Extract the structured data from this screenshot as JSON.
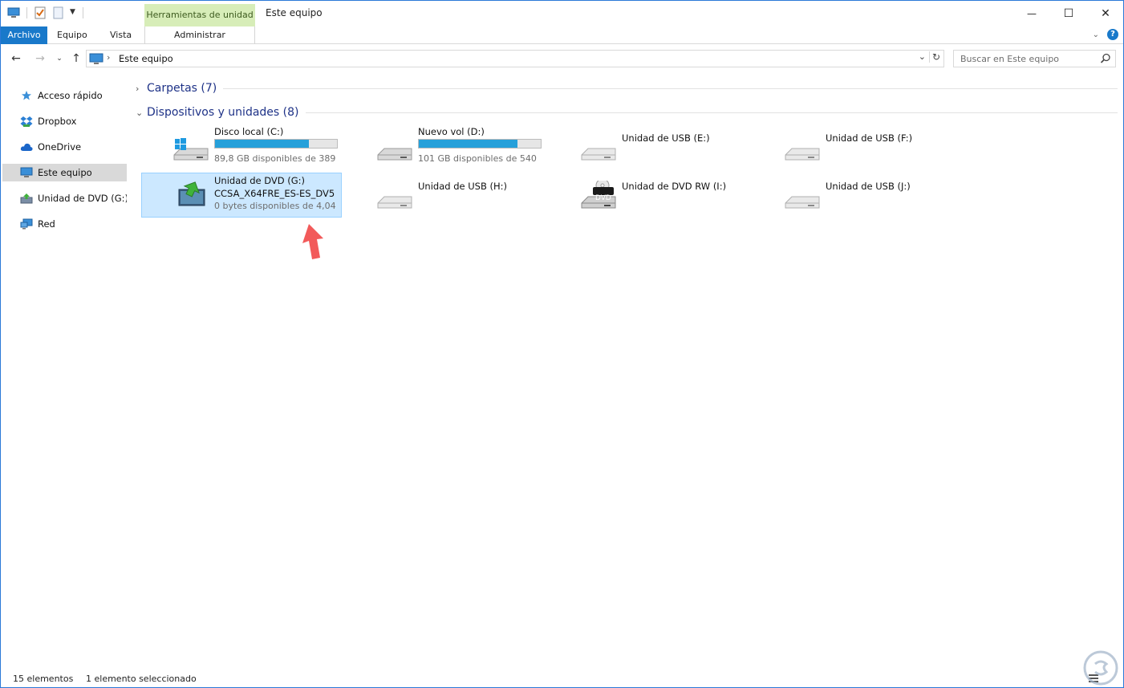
{
  "titlebar": {
    "context_tab": "Herramientas de unidad",
    "title": "Este equipo",
    "minimize": "—",
    "maximize": "☐",
    "close": "✕"
  },
  "ribbon": {
    "tabs": [
      "Archivo",
      "Equipo",
      "Vista"
    ],
    "context_sub": "Administrar"
  },
  "address": {
    "path": "Este equipo",
    "search_placeholder": "Buscar en Este equipo"
  },
  "sidebar": {
    "items": [
      {
        "label": "Acceso rápido",
        "icon": "star-icon"
      },
      {
        "label": "Dropbox",
        "icon": "dropbox-icon"
      },
      {
        "label": "OneDrive",
        "icon": "cloud-icon"
      },
      {
        "label": "Este equipo",
        "icon": "computer-icon",
        "selected": true
      },
      {
        "label": "Unidad de DVD (G:) C",
        "icon": "dvd-drive-icon"
      },
      {
        "label": "Red",
        "icon": "network-icon"
      }
    ]
  },
  "groups": {
    "folders": "Carpetas (7)",
    "devices": "Dispositivos y unidades (8)"
  },
  "drives": {
    "c": {
      "name": "Disco local (C:)",
      "free": "89,8 GB disponibles de 389",
      "used_fraction": 0.77
    },
    "d": {
      "name": "Nuevo vol (D:)",
      "free": "101 GB disponibles de 540",
      "used_fraction": 0.81
    },
    "e": {
      "name": "Unidad de USB (E:)"
    },
    "f": {
      "name": "Unidad de USB (F:)"
    },
    "g": {
      "name": "Unidad de DVD (G:)",
      "label": "CCSA_X64FRE_ES-ES_DV5",
      "free": "0 bytes disponibles de 4,04"
    },
    "h": {
      "name": "Unidad de USB (H:)"
    },
    "i": {
      "name": "Unidad de DVD RW (I:)",
      "badge": "DVD"
    },
    "j": {
      "name": "Unidad de USB (J:)"
    }
  },
  "status": {
    "count": "15 elementos",
    "selection": "1 elemento seleccionado"
  },
  "colors": {
    "accent": "#1979ca",
    "selection": "#cce8ff",
    "bar_fill": "#26a0da",
    "group_title": "#1e3287",
    "arrow": "#f25a5a"
  }
}
